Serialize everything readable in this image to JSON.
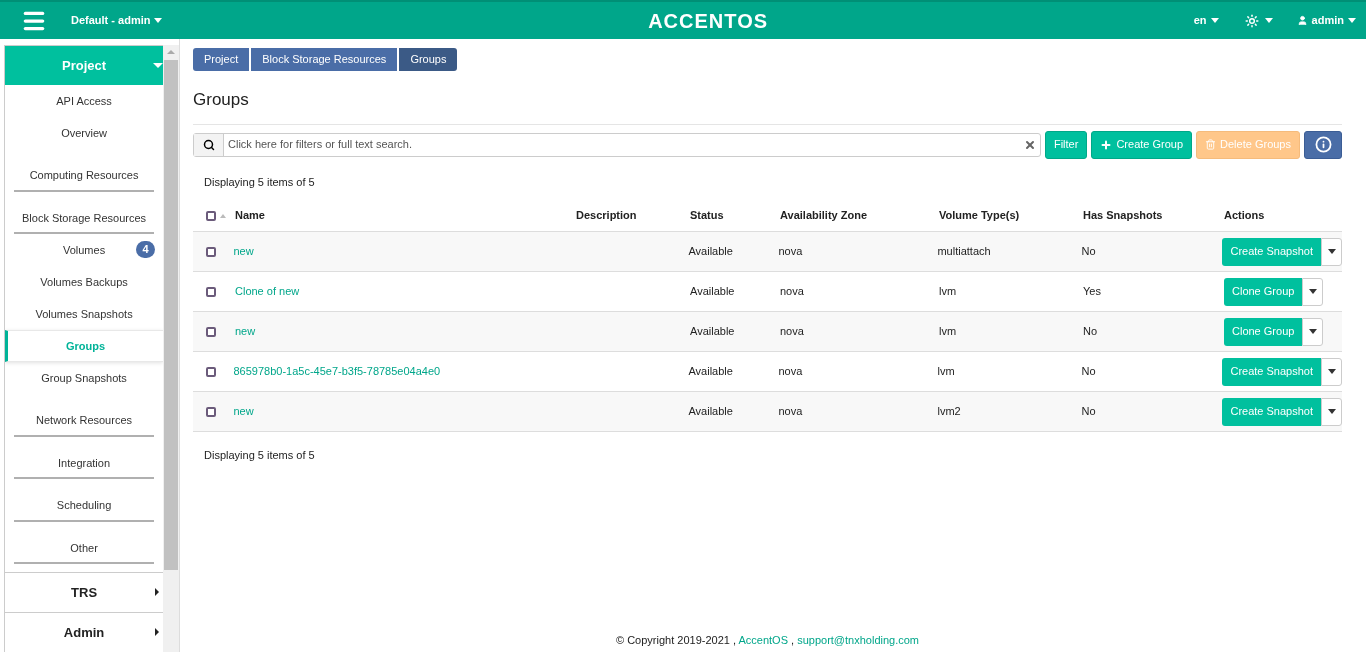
{
  "topbar": {
    "project": "Default - admin",
    "logo": "ACCENTOS",
    "language": "en",
    "user": "admin"
  },
  "sidebar": {
    "panels": [
      {
        "label": "Project",
        "expanded": true,
        "items": [
          {
            "kind": "link",
            "label": "API Access",
            "selected": false
          },
          {
            "kind": "link",
            "label": "Overview",
            "selected": false
          },
          {
            "kind": "category",
            "label": "Computing Resources",
            "selected": false
          },
          {
            "kind": "category",
            "label": "Block Storage Resources",
            "selected": false
          },
          {
            "kind": "link",
            "label": "Volumes",
            "badge": "4",
            "selected": false
          },
          {
            "kind": "link",
            "label": "Volumes Backups",
            "selected": false
          },
          {
            "kind": "link",
            "label": "Volumes Snapshots",
            "selected": false
          },
          {
            "kind": "link",
            "label": "Groups",
            "selected": true
          },
          {
            "kind": "link",
            "label": "Group Snapshots",
            "selected": false
          },
          {
            "kind": "category",
            "label": "Network Resources",
            "selected": false
          },
          {
            "kind": "category",
            "label": "Integration",
            "selected": false
          },
          {
            "kind": "category",
            "label": "Scheduling",
            "selected": false
          },
          {
            "kind": "category",
            "label": "Other",
            "selected": false
          }
        ]
      },
      {
        "label": "TRS",
        "expanded": false
      },
      {
        "label": "Admin",
        "expanded": false
      }
    ]
  },
  "breadcrumb": [
    "Project",
    "Block Storage Resources",
    "Groups"
  ],
  "page_title": "Groups",
  "search": {
    "placeholder": "Click here for filters or full text search."
  },
  "toolbar": [
    {
      "kind": "filter",
      "label": "Filter",
      "disabled": false
    },
    {
      "kind": "create",
      "label": "Create Group",
      "disabled": false
    },
    {
      "kind": "delete",
      "label": "Delete Groups",
      "disabled": true
    },
    {
      "kind": "info",
      "disabled": false
    }
  ],
  "count_top": "Displaying 5 items of 5",
  "table": {
    "select_all_checked": false,
    "columns": [
      "Name",
      "Description",
      "Status",
      "Availability Zone",
      "Volume Type(s)",
      "Has Snapshots",
      "Actions"
    ],
    "rows": [
      {
        "checked": false,
        "name": "new",
        "status": "Available",
        "zone": "nova",
        "types": "multiattach",
        "snapshots": "No",
        "action": "Create Snapshot"
      },
      {
        "checked": false,
        "name": "Clone of new",
        "status": "Available",
        "zone": "nova",
        "types": "lvm",
        "snapshots": "Yes",
        "action": "Clone Group"
      },
      {
        "checked": false,
        "name": "new",
        "status": "Available",
        "zone": "nova",
        "types": "lvm",
        "snapshots": "No",
        "action": "Clone Group"
      },
      {
        "checked": false,
        "name": "865978b0-1a5c-45e7-b3f5-78785e04a4e0",
        "status": "Available",
        "zone": "nova",
        "types": "lvm",
        "snapshots": "No",
        "action": "Create Snapshot"
      },
      {
        "checked": false,
        "name": "new",
        "status": "Available",
        "zone": "nova",
        "types": "lvm2",
        "snapshots": "No",
        "action": "Create Snapshot"
      }
    ]
  },
  "count_bottom": "Displaying 5 items of 5",
  "footer": [
    {
      "kind": "text",
      "text": "© Copyright 2019-2021 ,"
    },
    {
      "kind": "link",
      "text": "AccentOS"
    },
    {
      "kind": "text",
      "text": ","
    },
    {
      "kind": "link",
      "text": "support@tnxholding.com"
    }
  ]
}
